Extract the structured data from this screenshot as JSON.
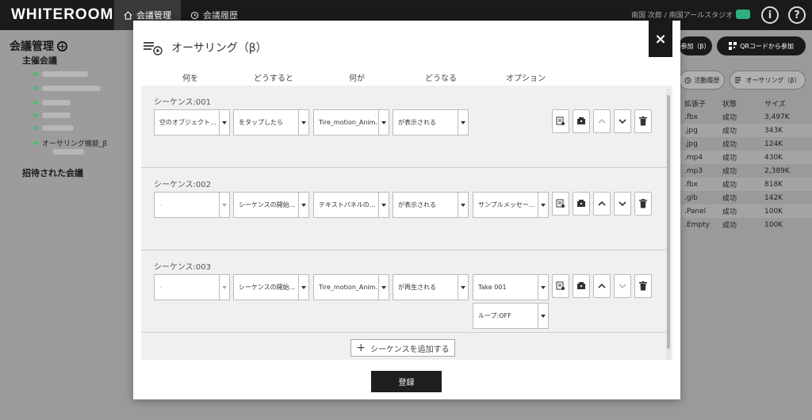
{
  "app": {
    "logo": "WHITEROOM",
    "nav": [
      {
        "label": "会議管理"
      },
      {
        "label": "会議履歴"
      }
    ],
    "user": "南国 次郎 / 南国アールスタジオ",
    "info_label": "i",
    "help_label": "?"
  },
  "sidebar": {
    "title": "会議管理",
    "hosted_label": "主催会議",
    "items": [
      {
        "label": "オーサリング機能_β"
      }
    ],
    "invited_label": "招待された会議"
  },
  "bg_buttons": {
    "join": "参加（β）",
    "qr_join": "QRコードから参加",
    "activity": "活動履歴",
    "authoring": "オーサリング（β）"
  },
  "file_table": {
    "headers": [
      "拡張子",
      "状態",
      "サイズ"
    ],
    "rows": [
      [
        ".fbx",
        "成功",
        "3,497K"
      ],
      [
        ".jpg",
        "成功",
        "343K"
      ],
      [
        ".jpg",
        "成功",
        "124K"
      ],
      [
        ".mp4",
        "成功",
        "430K"
      ],
      [
        ".mp3",
        "成功",
        "2,389K"
      ],
      [
        ".fbx",
        "成功",
        "818K"
      ],
      [
        ".glb",
        "成功",
        "142K"
      ],
      [
        ".Panel",
        "成功",
        "100K"
      ],
      [
        ".Empty",
        "成功",
        "100K"
      ]
    ]
  },
  "modal": {
    "title": "オーサリング（β）",
    "close_label": "×",
    "columns": [
      "何を",
      "どうすると",
      "何が",
      "どうなる",
      "オプション"
    ],
    "sequences": [
      {
        "label": "シーケンス:001",
        "what": "空のオブジェクト...",
        "action": "をタップしたら",
        "target": "Tire_motion_Anim...",
        "result": "が表示される"
      },
      {
        "label": "シーケンス:002",
        "what": "-",
        "action": "シーケンスの開始...",
        "target": "テキストパネルの...",
        "result": "が表示される",
        "option": "サンプルメッセー..."
      },
      {
        "label": "シーケンス:003",
        "what": "-",
        "action": "シーケンスの開始...",
        "target": "Tire_motion_Anim...",
        "result": "が再生される",
        "option": "Take 001",
        "option2": "ループ:OFF"
      }
    ],
    "add_sequence": "シーケンスを追加する",
    "register": "登録"
  }
}
